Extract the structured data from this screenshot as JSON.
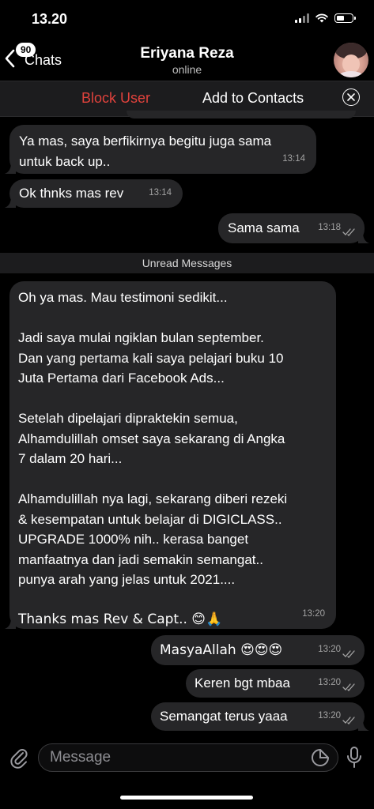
{
  "status_bar": {
    "time": "13.20"
  },
  "header": {
    "back_badge": "90",
    "back_label": "Chats",
    "contact_name": "Eriyana Reza",
    "contact_status": "online"
  },
  "action_bar": {
    "block_label": "Block User",
    "add_label": "Add to Contacts"
  },
  "messages": [
    {
      "dir": "in",
      "lines": [
        "Ya mas, saya berfikirnya begitu juga sama",
        "untuk back up.."
      ],
      "time": "13:14"
    },
    {
      "dir": "in",
      "lines": [
        "Ok thnks mas rev"
      ],
      "time": "13:14"
    },
    {
      "dir": "out",
      "lines": [
        "Sama sama"
      ],
      "time": "13:18"
    },
    {
      "dir": "in",
      "lines": [
        "Oh ya mas. Mau testimoni sedikit...",
        "",
        "Jadi saya mulai ngiklan bulan september.",
        "Dan yang pertama kali saya pelajari buku 10",
        "Juta Pertama dari Facebook Ads...",
        "",
        "Setelah dipelajari dipraktekin semua,",
        "Alhamdulillah omset saya sekarang di Angka",
        "7 dalam 20 hari...",
        "",
        "Alhamdulillah nya lagi, sekarang diberi rezeki",
        "& kesempatan untuk belajar di DIGICLASS..",
        "UPGRADE 1000% nih.. kerasa banget",
        "manfaatnya dan jadi semakin semangat..",
        "punya arah yang jelas untuk 2021....",
        "",
        "Thanks mas Rev & Capt.. 😊🙏"
      ],
      "time": "13:20"
    },
    {
      "dir": "out",
      "lines": [
        "MasyaAllah 😍😍😍"
      ],
      "time": "13:20"
    },
    {
      "dir": "out",
      "lines": [
        "Keren bgt mbaa"
      ],
      "time": "13:20"
    },
    {
      "dir": "out",
      "lines": [
        "Semangat terus yaaa"
      ],
      "time": "13:20"
    }
  ],
  "unread_label": "Unread Messages",
  "input": {
    "placeholder": "Message"
  },
  "icons": {
    "back": "chevron-left-icon",
    "close": "close-circle-icon",
    "attach": "paperclip-icon",
    "sticker": "sticker-icon",
    "mic": "microphone-icon",
    "read": "double-check-icon"
  },
  "colors": {
    "bubble": "#262628",
    "block": "#e0423c",
    "background": "#000000"
  }
}
